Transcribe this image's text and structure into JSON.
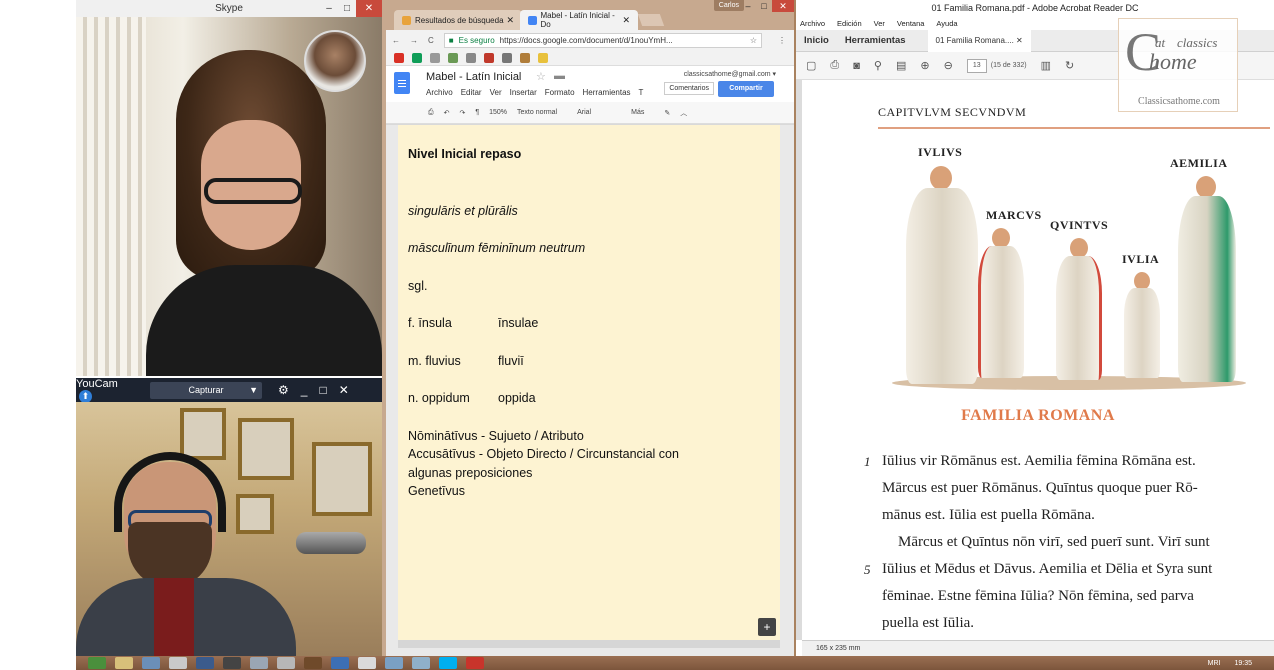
{
  "skype": {
    "title": "Skype",
    "controls": {
      "minimize": "–",
      "maximize": "□",
      "close": "✕"
    }
  },
  "youcam": {
    "brand": "YouCam",
    "capture_label": "Capturar",
    "dropdown_arrow": "▼",
    "icons": {
      "settings": "⚙",
      "minimize": "_",
      "maximize": "□",
      "close": "✕"
    }
  },
  "chrome": {
    "profile_name": "Carlos",
    "window_controls": {
      "minimize": "–",
      "maximize": "□",
      "close": "✕"
    },
    "tabs": [
      {
        "label": "Resultados de búsqueda",
        "close": "✕"
      },
      {
        "label": "Mabel - Latín Inicial - Do",
        "close": "✕"
      }
    ],
    "omnibar": {
      "back": "←",
      "forward": "→",
      "reload": "C",
      "secure_label": "Es seguro",
      "url": "https://docs.google.com/document/d/1nouYmH...",
      "star": "☆",
      "menu": "⋮"
    },
    "docs": {
      "title": "Mabel - Latín Inicial",
      "star": "☆",
      "folder": "▬",
      "account": "classicsathome@gmail.com ▾",
      "menu": [
        "Archivo",
        "Editar",
        "Ver",
        "Insertar",
        "Formato",
        "Herramientas",
        "T"
      ],
      "comments_label": "Comentarios",
      "share_label": "Compartir",
      "toolbar": {
        "zoom": "150%",
        "style": "Texto normal",
        "font": "Arial",
        "more": "Más",
        "print": "⎙",
        "undo": "↶",
        "redo": "↷",
        "paint": "¶",
        "pencil": "✎",
        "collapse": "︿"
      },
      "plus_button": "+"
    },
    "document": {
      "heading": "Nivel Inicial repaso",
      "line_numbers": "singulāris et plūrālis",
      "line_genders": "māsculīnum fēminīnum neutrum",
      "line_sgl": "sgl.",
      "rows": [
        {
          "left": "f. īnsula",
          "right": "īnsulae"
        },
        {
          "left": "m. fluvius",
          "right": "fluviī"
        },
        {
          "left": "n. oppidum",
          "right": "oppida"
        }
      ],
      "cases": [
        "Nōminātīvus - Sujueto / Atributo",
        "Accusātīvus -  Objeto Directo / Circunstancial con",
        "algunas preposiciones",
        "Genetīvus"
      ]
    }
  },
  "acrobat": {
    "title": "01 Familia Romana.pdf - Adobe Acrobat Reader DC",
    "menu": [
      "Archivo",
      "Edición",
      "Ver",
      "Ventana",
      "Ayuda"
    ],
    "tabs": {
      "home": "Inicio",
      "tools": "Herramientas",
      "doc": "01 Familia Romana....",
      "doc_close": "✕"
    },
    "page_current": "13",
    "page_total": "(15 de 332)",
    "status_size": "165 x 235 mm",
    "watermark": {
      "letter": "C",
      "at": "at",
      "word": "home",
      "site": "Classicsathome.com",
      "classics": "classics"
    },
    "page": {
      "chapter": "CAPITVLVM SECVNDVM",
      "figures": [
        "IVLIVS",
        "MARCVS",
        "QVINTVS",
        "IVLIA",
        "AEMILIA"
      ],
      "figure_title": "FAMILIA ROMANA",
      "lines": [
        {
          "num": "1",
          "text": "Iūlius vir Rōmānus est. Aemilia fēmina Rōmāna est."
        },
        {
          "num": "",
          "text": "Mārcus est puer Rōmānus. Quīntus quoque puer Rō-"
        },
        {
          "num": "",
          "text": "mānus est. Iūlia est puella Rōmāna."
        },
        {
          "num": "",
          "text": "Mārcus et Quīntus nōn virī, sed puerī sunt. Virī sunt"
        },
        {
          "num": "5",
          "text": "Iūlius et Mēdus et Dāvus. Aemilia et Dēlia et Syra sunt"
        },
        {
          "num": "",
          "text": "fēminae. Estne fēmina Iūlia? Nōn fēmina, sed parva"
        },
        {
          "num": "",
          "text": "puella est Iūlia."
        }
      ]
    }
  },
  "taskbar": {
    "tray_lang": "MRI",
    "clock": "19:35"
  }
}
